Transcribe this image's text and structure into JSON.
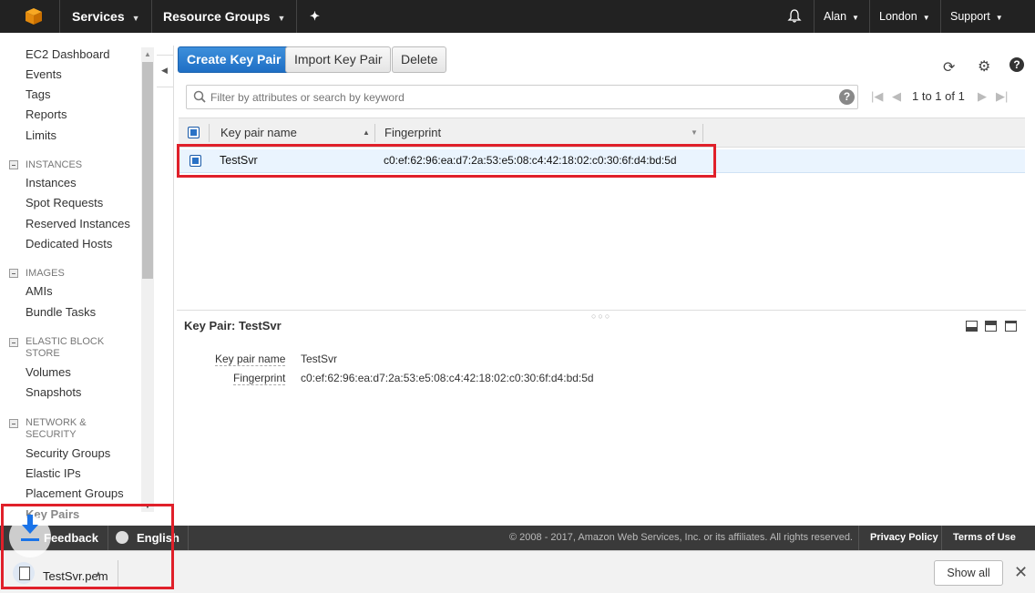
{
  "topnav": {
    "services": "Services",
    "resource_groups": "Resource Groups",
    "user": "Alan",
    "region": "London",
    "support": "Support"
  },
  "sidebar": {
    "top_links": [
      "EC2 Dashboard",
      "Events",
      "Tags",
      "Reports",
      "Limits"
    ],
    "sections": [
      {
        "title": "INSTANCES",
        "items": [
          "Instances",
          "Spot Requests",
          "Reserved Instances",
          "Dedicated Hosts"
        ]
      },
      {
        "title": "IMAGES",
        "items": [
          "AMIs",
          "Bundle Tasks"
        ]
      },
      {
        "title": "ELASTIC BLOCK STORE",
        "items": [
          "Volumes",
          "Snapshots"
        ]
      },
      {
        "title": "NETWORK & SECURITY",
        "items": [
          "Security Groups",
          "Elastic IPs",
          "Placement Groups",
          "Key Pairs"
        ]
      }
    ]
  },
  "toolbar": {
    "create": "Create Key Pair",
    "import": "Import Key Pair",
    "delete": "Delete"
  },
  "search": {
    "placeholder": "Filter by attributes or search by keyword"
  },
  "pager": {
    "text": "1 to 1 of 1"
  },
  "grid": {
    "columns": [
      "Key pair name",
      "Fingerprint"
    ],
    "rows": [
      {
        "name": "TestSvr",
        "fingerprint": "c0:ef:62:96:ea:d7:2a:53:e5:08:c4:42:18:02:c0:30:6f:d4:bd:5d"
      }
    ]
  },
  "detail": {
    "title": "Key Pair: TestSvr",
    "fields": [
      {
        "label": "Key pair name",
        "value": "TestSvr"
      },
      {
        "label": "Fingerprint",
        "value": "c0:ef:62:96:ea:d7:2a:53:e5:08:c4:42:18:02:c0:30:6f:d4:bd:5d"
      }
    ]
  },
  "footer": {
    "feedback": "Feedback",
    "language": "English",
    "copyright": "© 2008 - 2017, Amazon Web Services, Inc. or its affiliates. All rights reserved.",
    "privacy": "Privacy Policy",
    "terms": "Terms of Use"
  },
  "download_bar": {
    "file_name": "TestSvr.pem",
    "show_all": "Show all"
  },
  "colors": {
    "primary": "#1f6fc5",
    "highlight": "#e0202a",
    "nav_bg": "#222222"
  }
}
